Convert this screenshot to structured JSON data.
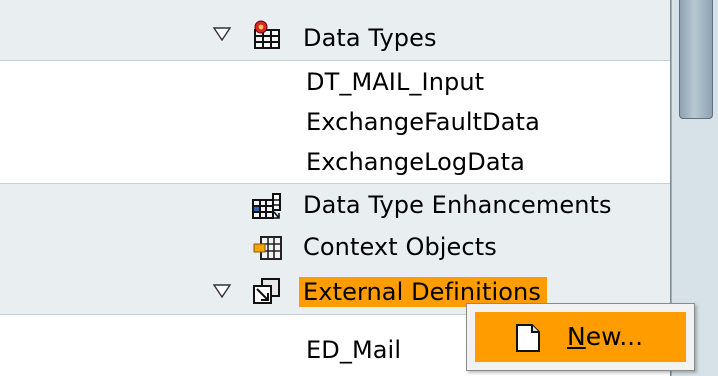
{
  "tree": {
    "rows": [
      {
        "label": "Data Types",
        "icon": "data-types-icon",
        "expanded": true
      },
      {
        "label": "DT_MAIL_Input"
      },
      {
        "label": "ExchangeFaultData"
      },
      {
        "label": "ExchangeLogData"
      },
      {
        "label": "Data Type Enhancements",
        "icon": "data-type-enhancements-icon"
      },
      {
        "label": "Context Objects",
        "icon": "context-objects-icon"
      },
      {
        "label": "External Definitions",
        "icon": "external-definitions-icon",
        "expanded": true,
        "selected": true
      },
      {
        "label": "ED_Mail"
      }
    ]
  },
  "context_menu": {
    "items": [
      {
        "label": "New...",
        "accelerator_char": "N",
        "rest": "ew...",
        "icon": "new-document-icon"
      }
    ]
  },
  "colors": {
    "selection": "#ff9d00",
    "row_shaded": "#e9eef1",
    "scrollbar_track": "#d7e1e8",
    "scrollbar_thumb": "#8ea2b3"
  }
}
